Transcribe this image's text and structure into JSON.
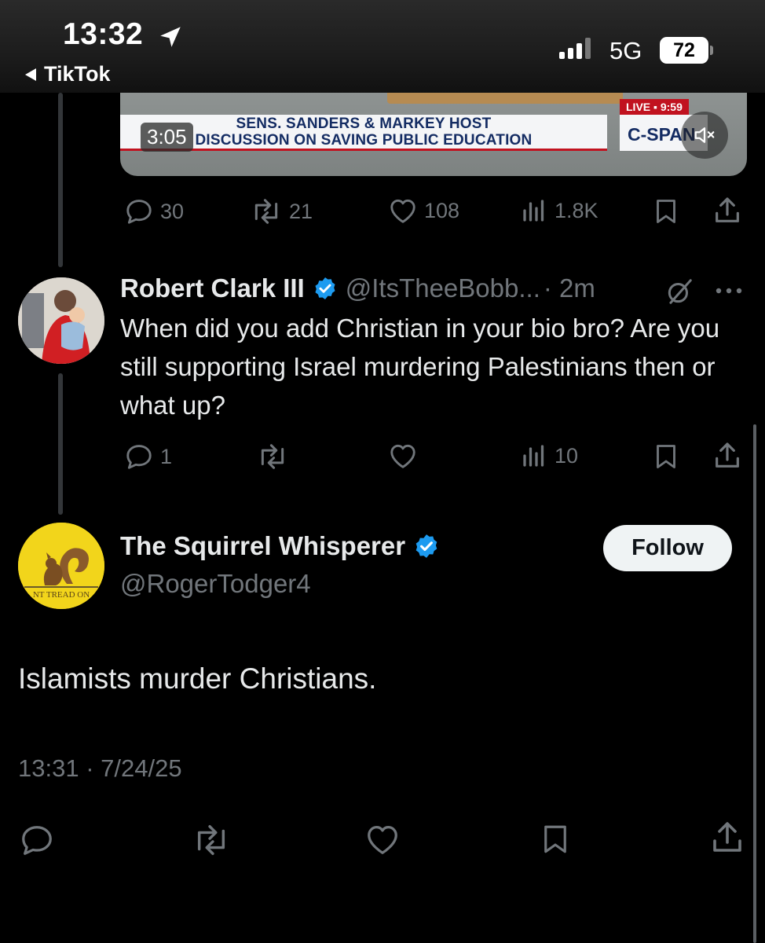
{
  "status_bar": {
    "time": "13:32",
    "back_app": "TikTok",
    "network": "5G",
    "battery": "72"
  },
  "video": {
    "duration": "3:05",
    "banner_line1": "SENS. SANDERS & MARKEY HOST",
    "banner_line2": "DISCUSSION ON SAVING PUBLIC EDUCATION",
    "live_tag": "LIVE ▪ 9:59",
    "network_logo": "C-SPAN"
  },
  "original_tweet_actions": {
    "replies": "30",
    "retweets": "21",
    "likes": "108",
    "views": "1.8K"
  },
  "reply_tweet": {
    "display_name": "Robert Clark III",
    "handle": "@ItsTheeBobb...",
    "time_ago": "· 2m",
    "text": "When did you add Christian in your bio bro? Are you still supporting Israel murdering Palestinians then or what up?",
    "replies": "1",
    "views": "10"
  },
  "main_tweet": {
    "display_name": "The Squirrel Whisperer",
    "handle": "@RogerTodger4",
    "follow_label": "Follow",
    "text": "Islamists murder Christians.",
    "timestamp": "13:31 · 7/24/25",
    "avatar_text": "NT TREAD ON"
  },
  "colors": {
    "background": "#000000",
    "secondary_text": "#71767b",
    "verified_blue": "#1d9bf0",
    "avatar_yellow": "#f2d51b"
  }
}
